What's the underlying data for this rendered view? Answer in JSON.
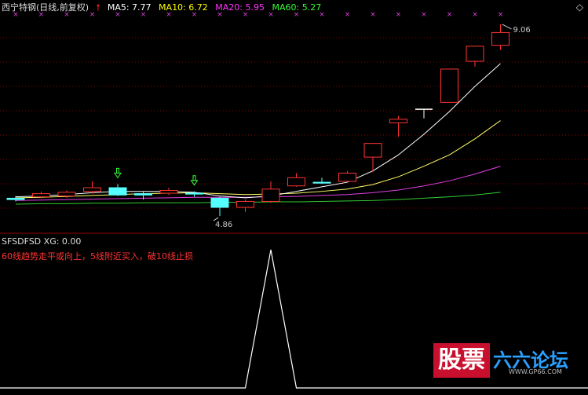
{
  "header": {
    "title": "西宁特钢(日线,前复权)",
    "ma": [
      {
        "label": "MA5: 7.77",
        "color": "#ffffff"
      },
      {
        "label": "MA10: 6.72",
        "color": "#ffff00"
      },
      {
        "label": "MA20: 5.95",
        "color": "#ff33ff"
      },
      {
        "label": "MA60: 5.27",
        "color": "#33ff33"
      }
    ]
  },
  "indicator": {
    "title": "SFSDFSD",
    "xg_label": "XG: 0.00",
    "note": "60线趋势走平或向上，5线附近买入，破10线止损"
  },
  "watermark": {
    "big": "股票",
    "mid": "六六论坛",
    "url": "WWW.GP66.COM"
  },
  "chart_data": {
    "type": "candlestick",
    "ylim": [
      4.5,
      9.3
    ],
    "high_label": "9.06",
    "low_label": "4.86",
    "candles": [
      {
        "o": 5.25,
        "h": 5.3,
        "l": 5.18,
        "c": 5.22
      },
      {
        "o": 5.28,
        "h": 5.4,
        "l": 5.25,
        "c": 5.35
      },
      {
        "o": 5.3,
        "h": 5.42,
        "l": 5.26,
        "c": 5.38
      },
      {
        "o": 5.4,
        "h": 5.62,
        "l": 5.35,
        "c": 5.48
      },
      {
        "o": 5.48,
        "h": 5.56,
        "l": 5.3,
        "c": 5.32
      },
      {
        "o": 5.35,
        "h": 5.4,
        "l": 5.22,
        "c": 5.32
      },
      {
        "o": 5.36,
        "h": 5.48,
        "l": 5.32,
        "c": 5.42
      },
      {
        "o": 5.36,
        "h": 5.4,
        "l": 5.28,
        "c": 5.34
      },
      {
        "o": 5.25,
        "h": 5.28,
        "l": 4.86,
        "c": 5.05
      },
      {
        "o": 5.05,
        "h": 5.22,
        "l": 4.95,
        "c": 5.18
      },
      {
        "o": 5.18,
        "h": 5.62,
        "l": 5.15,
        "c": 5.45
      },
      {
        "o": 5.52,
        "h": 5.8,
        "l": 5.5,
        "c": 5.7
      },
      {
        "o": 5.6,
        "h": 5.7,
        "l": 5.56,
        "c": 5.58
      },
      {
        "o": 5.62,
        "h": 5.85,
        "l": 5.6,
        "c": 5.8
      },
      {
        "o": 6.15,
        "h": 6.45,
        "l": 5.82,
        "c": 6.45
      },
      {
        "o": 6.9,
        "h": 7.05,
        "l": 6.6,
        "c": 6.98
      },
      {
        "o": 7.2,
        "h": 7.2,
        "l": 7.0,
        "c": 7.2
      },
      {
        "o": 7.35,
        "h": 8.08,
        "l": 7.35,
        "c": 8.08
      },
      {
        "o": 8.25,
        "h": 8.58,
        "l": 8.13,
        "c": 8.58
      },
      {
        "o": 8.6,
        "h": 9.06,
        "l": 8.5,
        "c": 8.88
      }
    ],
    "buy_arrows": [
      4,
      7
    ],
    "top_marks": [
      0,
      1,
      2,
      3,
      4,
      5,
      6,
      7,
      8,
      9,
      10,
      11,
      12,
      13,
      14,
      15,
      16,
      17,
      18,
      19
    ],
    "ma5": [
      5.28,
      5.3,
      5.33,
      5.37,
      5.4,
      5.4,
      5.4,
      5.38,
      5.3,
      5.26,
      5.3,
      5.4,
      5.5,
      5.6,
      5.85,
      6.2,
      6.65,
      7.15,
      7.7,
      8.2
    ],
    "ma10": [
      5.26,
      5.27,
      5.29,
      5.31,
      5.33,
      5.35,
      5.36,
      5.37,
      5.35,
      5.33,
      5.34,
      5.36,
      5.4,
      5.45,
      5.55,
      5.72,
      5.95,
      6.2,
      6.55,
      6.95
    ],
    "ma20": [
      5.2,
      5.21,
      5.22,
      5.23,
      5.24,
      5.25,
      5.26,
      5.27,
      5.27,
      5.27,
      5.28,
      5.29,
      5.31,
      5.33,
      5.37,
      5.43,
      5.52,
      5.63,
      5.78,
      5.95
    ],
    "ma60": [
      5.12,
      5.13,
      5.13,
      5.14,
      5.14,
      5.15,
      5.15,
      5.15,
      5.16,
      5.16,
      5.17,
      5.17,
      5.18,
      5.19,
      5.2,
      5.22,
      5.25,
      5.28,
      5.32,
      5.38
    ],
    "indicator_values": [
      0,
      0,
      0,
      0,
      0,
      0,
      0,
      0,
      0,
      0,
      1,
      0,
      0,
      0,
      0,
      0,
      0,
      0,
      0,
      0
    ],
    "colors": {
      "up": "#ff3333",
      "down": "#55ffff",
      "cross": "#ffffff",
      "grid": "#8b0000"
    }
  }
}
